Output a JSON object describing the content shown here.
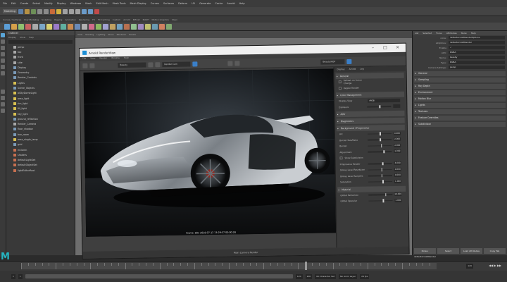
{
  "app": {
    "menu": [
      "File",
      "Edit",
      "Create",
      "Select",
      "Modify",
      "Display",
      "Windows",
      "Mesh",
      "Edit Mesh",
      "Mesh Tools",
      "Mesh Display",
      "Curves",
      "Surfaces",
      "Deform",
      "UV",
      "Generate",
      "Cache",
      "Arnold",
      "Help"
    ],
    "workspace_mode": "Modeling",
    "shelf_tabs": [
      "Curves / Surfaces",
      "Poly Modeling",
      "Sculpting",
      "Rigging",
      "Animation",
      "Rendering",
      "FX",
      "FX Caching",
      "Custom",
      "Arnold",
      "Bifrost",
      "MASH",
      "Motion Graphics",
      "XGen"
    ],
    "accent_color": "#1d8fd6"
  },
  "outliner": {
    "title": "Outliner",
    "menu": [
      "Display",
      "Show",
      "Help"
    ],
    "items": [
      {
        "label": "persp",
        "type": "cam"
      },
      {
        "label": "top",
        "type": "cam"
      },
      {
        "label": "front",
        "type": "cam"
      },
      {
        "label": "side",
        "type": "cam"
      },
      {
        "label": "Display",
        "type": "mesh"
      },
      {
        "label": "Geometry",
        "type": "mesh"
      },
      {
        "label": "Render_Controls",
        "type": "mesh"
      },
      {
        "label": "Lights",
        "type": "light"
      },
      {
        "label": "Scene_Objects",
        "type": "mesh"
      },
      {
        "label": "aiSkyDomeLight",
        "type": "light"
      },
      {
        "label": "area_light",
        "type": "light"
      },
      {
        "label": "rim_light",
        "type": "light"
      },
      {
        "label": "fill_light",
        "type": "light"
      },
      {
        "label": "key_light",
        "type": "light"
      },
      {
        "label": "ground_reflection",
        "type": "mesh"
      },
      {
        "label": "Render_Camera",
        "type": "cam"
      },
      {
        "label": "floor_shadow",
        "type": "mesh"
      },
      {
        "label": "box_room",
        "type": "mesh"
      },
      {
        "label": "area_single_lamp",
        "type": "light"
      },
      {
        "label": "grid",
        "type": "mesh"
      },
      {
        "label": "mclaren",
        "type": "set"
      },
      {
        "label": "shaders",
        "type": "set"
      },
      {
        "label": "defaultLightSet",
        "type": "set"
      },
      {
        "label": "defaultObjectSet",
        "type": "set"
      },
      {
        "label": "lightEditorRoot",
        "type": "set"
      }
    ]
  },
  "viewport": {
    "menu": [
      "View",
      "Shading",
      "Lighting",
      "Show",
      "Renderer",
      "Panels"
    ]
  },
  "render_view": {
    "title": "Arnold RenderView",
    "menu": [
      "File",
      "View",
      "Render",
      "Window",
      "Help"
    ],
    "camera_select": "Beauty",
    "aov_select": "Render Cam",
    "zoom_select": "Beauty/AOV",
    "caption": "Frame: 001   2018-07-12   13:29:37   00:00:28",
    "status": "Main Camera Render",
    "settings_tabs": [
      "Display",
      "Arnold",
      "Log"
    ],
    "sections": [
      {
        "label": "General",
        "rows": [
          {
            "label": "Refresh on Scene Change",
            "kind": "check"
          },
          {
            "label": "Region Render",
            "kind": "check"
          }
        ]
      },
      {
        "label": "Color Management",
        "rows": [
          {
            "label": "Display View",
            "kind": "field",
            "value": "sRGB"
          },
          {
            "label": "Exposure",
            "kind": "slider",
            "value": ""
          }
        ]
      },
      {
        "label": "AOV",
        "rows": []
      },
      {
        "label": "Diagnostics",
        "rows": []
      },
      {
        "label": "Background / Progressive",
        "rows": [
          {
            "label": "Arc",
            "kind": "slider",
            "value": "0.000",
            "pos": 0.5
          },
          {
            "label": "Bucket Size/Ratio",
            "kind": "slider",
            "value": "2.000",
            "pos": 0.5
          },
          {
            "label": "Bucket",
            "kind": "slider",
            "value": "2.000",
            "pos": 0.55
          },
          {
            "label": "Adjustment",
            "kind": "slider",
            "value": "1.000",
            "pos": 0.65
          },
          {
            "label": "Show Subdivision",
            "kind": "check"
          },
          {
            "label": "Progressive Render",
            "kind": "slider",
            "value": "3.000",
            "pos": 0.6
          },
          {
            "label": "Glossy Level Resolution",
            "kind": "slider",
            "value": "0.000",
            "pos": 0.55
          },
          {
            "label": "Glossy Level Samples",
            "kind": "slider",
            "value": "0.000",
            "pos": 0.55
          },
          {
            "label": "Saturation",
            "kind": "slider",
            "value": "1.000",
            "pos": 0.6
          }
        ]
      },
      {
        "label": "Material",
        "rows": [
          {
            "label": "Global Refraction",
            "kind": "slider",
            "value": "10.000",
            "pos": 0.7
          },
          {
            "label": "Global Specular",
            "kind": "slider",
            "value": "1.000",
            "pos": 0.6
          }
        ]
      }
    ]
  },
  "attribute_editor": {
    "tabs": [
      "List",
      "Selected",
      "Focus",
      "Attributes",
      "Show",
      "Help"
    ],
    "node_name": "defaultArnoldRenderOptions",
    "rows": [
      {
        "k": "aiOptions:",
        "v": "defaultArnoldRender"
      },
      {
        "k": "Enable",
        "v": "✓"
      },
      {
        "k": "AOV:",
        "v": "RGBA"
      },
      {
        "k": "Name:",
        "v": "beauty"
      },
      {
        "k": "Type:",
        "v": "RGBA"
      },
      {
        "k": "Camera Settings:",
        "v": "persp"
      }
    ],
    "sections": [
      "General",
      "Sampling",
      "Ray Depth",
      "Environment",
      "Motion Blur",
      "Lights",
      "Textures",
      "Feature Overrides",
      "Subdivision"
    ],
    "bottom_buttons": [
      "Notes: defaultArnoldRender",
      "Select",
      "Load Attributes",
      "Copy Tab"
    ]
  },
  "timeline": {
    "start": "1",
    "end": "120",
    "range_start": "1",
    "range_end": "200",
    "current": "120",
    "fps": "24 fps",
    "char_set": "No Character Set",
    "anim_layer": "No Anim Layer"
  }
}
